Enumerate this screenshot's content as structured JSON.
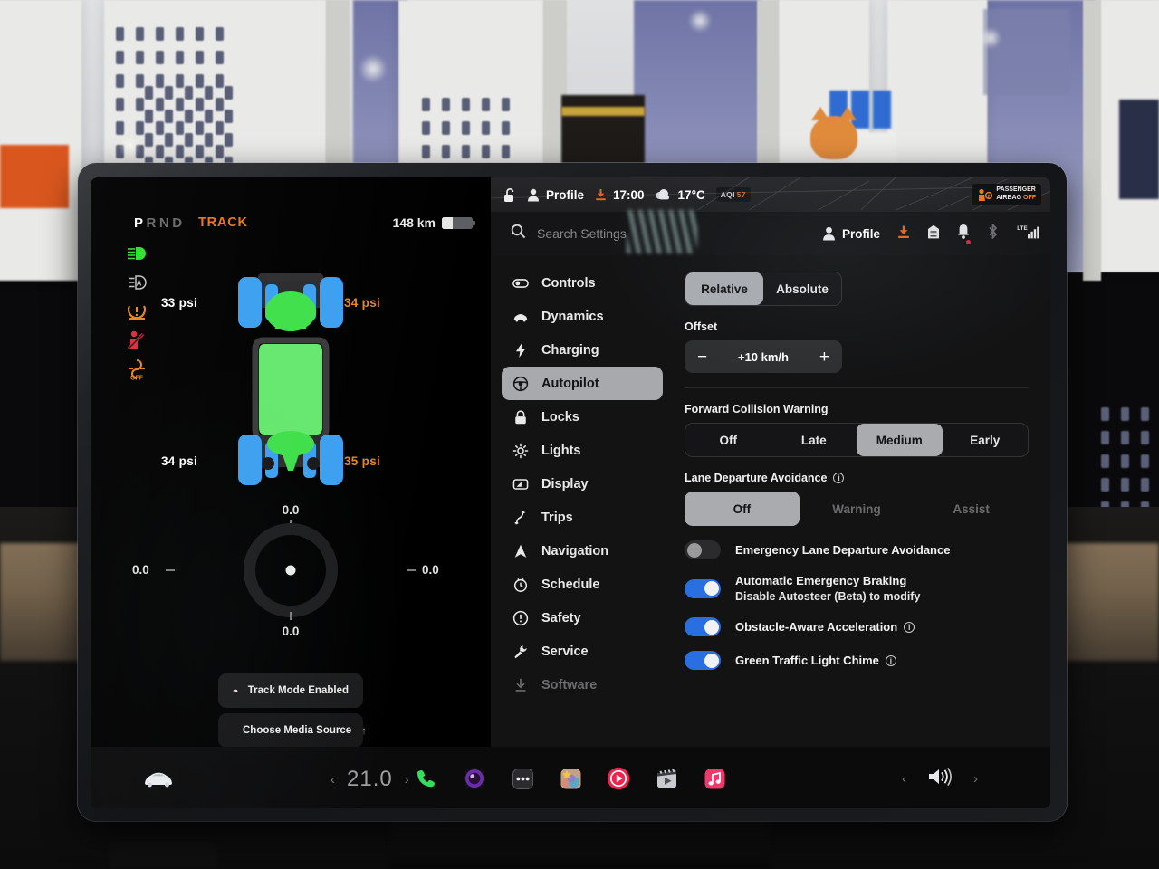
{
  "cluster": {
    "gear_letters": [
      "P",
      "R",
      "N",
      "D"
    ],
    "gear_active_index": 0,
    "track_label": "TRACK",
    "range": "148 km",
    "battery_percent": 35,
    "telltales": [
      {
        "name": "low-beam-headlight-indicator",
        "color": "#2ee02e"
      },
      {
        "name": "auto-high-beam-indicator",
        "color": "#cfcfcf"
      },
      {
        "name": "tire-pressure-warning-indicator",
        "color": "#e8861e"
      },
      {
        "name": "seatbelt-warning-indicator",
        "color": "#e02a3c"
      },
      {
        "name": "traction-control-off-indicator",
        "color": "#e8861e"
      }
    ],
    "tires": {
      "front_left": {
        "value": "33 psi",
        "tone": "white"
      },
      "front_right": {
        "value": "34 psi",
        "tone": "amber"
      },
      "rear_left": {
        "value": "34 psi",
        "tone": "white"
      },
      "rear_right": {
        "value": "35 psi",
        "tone": "amber"
      }
    },
    "gmeter": {
      "top": "0.0",
      "bottom": "0.0",
      "left": "0.0",
      "right": "0.0"
    },
    "toasts": [
      {
        "name": "track-mode-enabled",
        "label": "Track Mode Enabled",
        "icon": "car-warning-icon"
      },
      {
        "name": "choose-media-source",
        "label": "Choose Media Source",
        "icon": "music-note-icon",
        "trailing": "↑"
      }
    ]
  },
  "statusbar": {
    "lock_icon": "unlocked-icon",
    "profile": "Profile",
    "time": "17:00",
    "temperature": "17°C",
    "aqi_label": "AQI",
    "aqi_value": "57",
    "airbag_line1": "PASSENGER",
    "airbag_line2": "AIRBAG",
    "airbag_state": "OFF"
  },
  "search": {
    "placeholder": "Search Settings",
    "profile_label": "Profile",
    "icons": [
      {
        "name": "software-download-icon",
        "color": "#e8761e"
      },
      {
        "name": "card-reader-icon",
        "color": "#e8e8e8"
      },
      {
        "name": "notifications-bell-icon",
        "color": "#e8e8e8",
        "badge": true
      },
      {
        "name": "bluetooth-icon",
        "color": "#6e6e72"
      },
      {
        "name": "lte-signal-icon",
        "color": "#e8e8e8",
        "label": "LTE"
      }
    ]
  },
  "nav": {
    "items": [
      {
        "label": "Controls",
        "icon": "toggle-icon",
        "state": "normal"
      },
      {
        "label": "Dynamics",
        "icon": "car-icon",
        "state": "normal"
      },
      {
        "label": "Charging",
        "icon": "bolt-icon",
        "state": "normal"
      },
      {
        "label": "Autopilot",
        "icon": "steering-wheel-icon",
        "state": "active"
      },
      {
        "label": "Locks",
        "icon": "lock-icon",
        "state": "normal"
      },
      {
        "label": "Lights",
        "icon": "sun-icon",
        "state": "normal"
      },
      {
        "label": "Display",
        "icon": "display-icon",
        "state": "normal"
      },
      {
        "label": "Trips",
        "icon": "road-icon",
        "state": "normal"
      },
      {
        "label": "Navigation",
        "icon": "navigation-arrow-icon",
        "state": "normal"
      },
      {
        "label": "Schedule",
        "icon": "clock-icon",
        "state": "normal"
      },
      {
        "label": "Safety",
        "icon": "alert-circle-icon",
        "state": "normal"
      },
      {
        "label": "Service",
        "icon": "wrench-icon",
        "state": "normal"
      },
      {
        "label": "Software",
        "icon": "download-icon",
        "state": "dim"
      }
    ]
  },
  "content": {
    "speed_mode": {
      "options": [
        "Relative",
        "Absolute"
      ],
      "selected": "Relative"
    },
    "offset": {
      "label": "Offset",
      "value": "+10 km/h",
      "minus": "−",
      "plus": "+"
    },
    "forward_collision": {
      "label": "Forward Collision Warning",
      "options": [
        "Off",
        "Late",
        "Medium",
        "Early"
      ],
      "selected": "Medium"
    },
    "lane_departure": {
      "label": "Lane Departure Avoidance",
      "options": [
        "Off",
        "Warning",
        "Assist"
      ],
      "selected": "Off",
      "disabled": [
        "Warning",
        "Assist"
      ]
    },
    "toggles": [
      {
        "name": "emergency-lane-departure-avoidance",
        "label": "Emergency Lane Departure Avoidance",
        "state": "off",
        "info": false,
        "sub": ""
      },
      {
        "name": "automatic-emergency-braking",
        "label": "Automatic Emergency Braking",
        "state": "on",
        "info": false,
        "sub": "Disable Autosteer (Beta) to modify"
      },
      {
        "name": "obstacle-aware-acceleration",
        "label": "Obstacle-Aware Acceleration",
        "state": "on",
        "info": true,
        "sub": ""
      },
      {
        "name": "green-traffic-light-chime",
        "label": "Green Traffic Light Chime",
        "state": "on",
        "info": true,
        "sub": ""
      }
    ]
  },
  "dock": {
    "car_icon": "tesla-car-icon",
    "temperature": "21.0",
    "prev_chevron": "‹",
    "next_chevron": "›",
    "apps": [
      {
        "name": "phone-app-icon",
        "color": "#2ee05c"
      },
      {
        "name": "dashcam-app-icon",
        "color": "#6b2ea8"
      },
      {
        "name": "more-apps-icon",
        "color": "#2a2a2c"
      },
      {
        "name": "toybox-app-icon",
        "color": "#d9a24a"
      },
      {
        "name": "youtube-music-app-icon",
        "color": "#f0224e"
      },
      {
        "name": "video-app-icon",
        "color": "#b8b8bb"
      },
      {
        "name": "apple-music-app-icon",
        "color": "#f0386b"
      }
    ],
    "volume_icon": "volume-speaker-icon"
  },
  "colors": {
    "accent_orange": "#e8761e",
    "toggle_blue": "#2a6fe0",
    "selected_gray": "#a9abaf",
    "panel_bg": "#131314"
  }
}
